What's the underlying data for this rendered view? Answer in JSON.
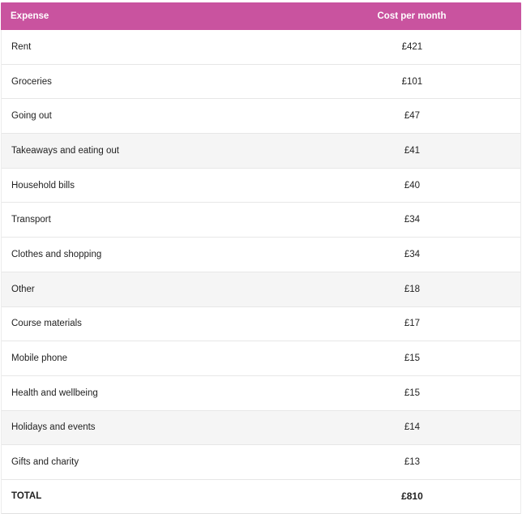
{
  "table": {
    "header": {
      "expense": "Expense",
      "cost": "Cost per month"
    },
    "rows": [
      {
        "expense": "Rent",
        "cost": "£421",
        "shaded": false
      },
      {
        "expense": "Groceries",
        "cost": "£101",
        "shaded": false
      },
      {
        "expense": "Going out",
        "cost": "£47",
        "shaded": false
      },
      {
        "expense": "Takeaways and eating out",
        "cost": "£41",
        "shaded": true
      },
      {
        "expense": "Household bills",
        "cost": "£40",
        "shaded": false
      },
      {
        "expense": "Transport",
        "cost": "£34",
        "shaded": false
      },
      {
        "expense": "Clothes and shopping",
        "cost": "£34",
        "shaded": false
      },
      {
        "expense": "Other",
        "cost": "£18",
        "shaded": true
      },
      {
        "expense": "Course materials",
        "cost": "£17",
        "shaded": false
      },
      {
        "expense": "Mobile phone",
        "cost": "£15",
        "shaded": false
      },
      {
        "expense": "Health and wellbeing",
        "cost": "£15",
        "shaded": false
      },
      {
        "expense": "Holidays and events",
        "cost": "£14",
        "shaded": true
      },
      {
        "expense": "Gifts and charity",
        "cost": "£13",
        "shaded": false
      }
    ],
    "total": {
      "label": "TOTAL",
      "value": "£810"
    }
  },
  "colors": {
    "header_bg": "#c9539f",
    "header_text": "#ffffff",
    "shaded_row": "#f5f5f5"
  }
}
